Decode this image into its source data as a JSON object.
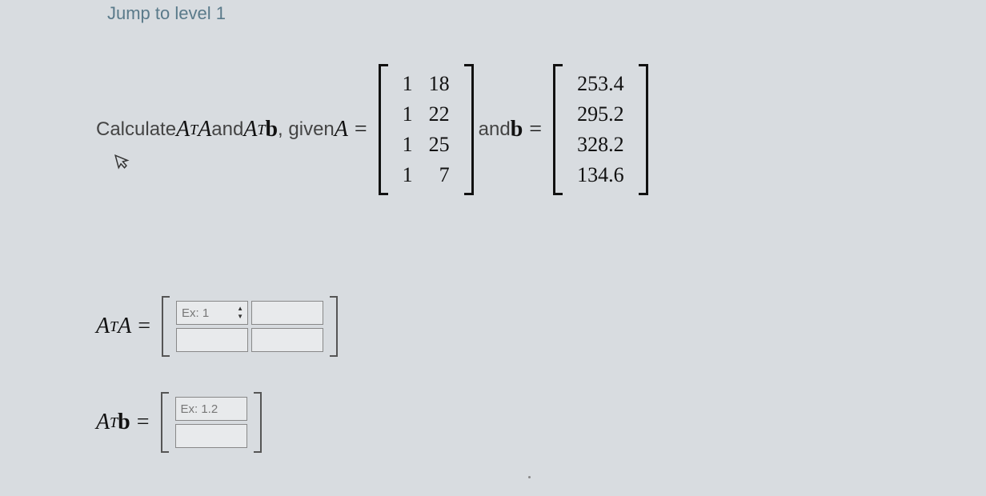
{
  "jump_link": "Jump to level 1",
  "question": {
    "prefix": "Calculate ",
    "mid1": " and ",
    "mid2": ", given ",
    "and_text": " and ",
    "symA": "A",
    "symb": "b",
    "supT": "T",
    "matrix_A": [
      [
        "1",
        "18"
      ],
      [
        "1",
        "22"
      ],
      [
        "1",
        "25"
      ],
      [
        "1",
        "7"
      ]
    ],
    "vector_b": [
      "253.4",
      "295.2",
      "328.2",
      "134.6"
    ]
  },
  "answers": {
    "ata_label_A": "A",
    "ata_sup": "T",
    "atb_label_A": "A",
    "atb_sup": "T",
    "atb_label_b": "b",
    "placeholder_int": "Ex: 1",
    "placeholder_dec": "Ex: 1.2"
  }
}
